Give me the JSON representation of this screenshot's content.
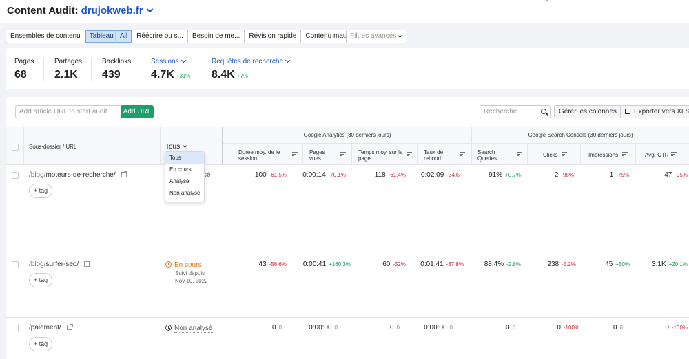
{
  "header": {
    "title": "Content Audit:",
    "domain": "drujokweb.fr"
  },
  "toolbar": {
    "view_group": [
      "Ensembles de contenu",
      "Tableau"
    ],
    "filter_group": [
      "All",
      "Réécrire ou s...",
      "Besoin de me...",
      "Révision rapide",
      "Contenu mau..."
    ],
    "advanced_filters": "Filtres avancés"
  },
  "stats": {
    "pages": {
      "label": "Pages",
      "value": "68"
    },
    "partages": {
      "label": "Partages",
      "value": "2.1K"
    },
    "backlinks": {
      "label": "Backlinks",
      "value": "439"
    },
    "sessions": {
      "label": "Sessions",
      "value": "4.7K",
      "delta": "+31%"
    },
    "requetes": {
      "label": "Requêtes de recherche",
      "value": "8.4K",
      "delta": "+7%"
    }
  },
  "actions": {
    "url_placeholder": "Add article URL to start audit",
    "add_url": "Add URL",
    "search_placeholder": "Recherche",
    "manage_columns": "Gérer les colonnes",
    "export": "Exporter vers XLSX"
  },
  "table": {
    "col_url": "Sous-dossier / URL",
    "status_filter": "Tous",
    "group_ga": "Google Analytics (30 derniers jours)",
    "group_gsc": "Google Search Console (30 derniers jours)",
    "cols": {
      "duree": "Durée moy. de le session",
      "pages_vues": "Pages vues",
      "temps": "Temps moy. sur la page",
      "taux": "Taux de rebond",
      "queries": "Search Queries",
      "clicks": "Clicks",
      "impressions": "Impressions",
      "ctr": "Avg. CTR"
    },
    "tag_label": "+ tag",
    "rows": [
      {
        "folder": "/blog/",
        "slug": "moteurs-de-recherche/",
        "status": "",
        "sub1": "",
        "sub2": "",
        "duree": "100",
        "duree_d": "-61.5%",
        "pages_vues": "0:00:14",
        "pages_vues_d": "-70.1%",
        "temps": "118",
        "temps_d": "-61.4%",
        "taux": "0:02:09",
        "taux_d": "-34%",
        "queries": "91%",
        "queries_d": "+0.7%",
        "clicks": "2",
        "clicks_d": "-98%",
        "impressions": "1",
        "impressions_d": "-75%",
        "ctr": "47",
        "ctr_d": "-95%"
      },
      {
        "folder": "/blog/",
        "slug": "surfer-seo/",
        "status": "En cours",
        "sub1": "Suivi depuis",
        "sub2": "Nov 10, 2022",
        "duree": "43",
        "duree_d": "-56.6%",
        "pages_vues": "0:00:41",
        "pages_vues_d": "+160.3%",
        "temps": "60",
        "temps_d": "-52%",
        "taux": "0:01:41",
        "taux_d": "-37.8%",
        "queries": "88.4%",
        "queries_d": "-2.8%",
        "clicks": "238",
        "clicks_d": "-5.2%",
        "impressions": "45",
        "impressions_d": "+50%",
        "ctr": "3.1K",
        "ctr_d": "+20.1%"
      },
      {
        "folder": "",
        "slug": "/paiement/",
        "status": "Non analysé",
        "sub1": "",
        "sub2": "",
        "duree": "0",
        "duree_d": "0",
        "pages_vues": "0:00:00",
        "pages_vues_d": "0",
        "temps": "0",
        "temps_d": "0",
        "taux": "0:00:00",
        "taux_d": "0",
        "queries": "0",
        "queries_d": "0",
        "clicks": "0",
        "clicks_d": "-100%",
        "impressions": "0",
        "impressions_d": "0",
        "ctr": "0",
        "ctr_d": "-100%"
      }
    ]
  },
  "dropdown": {
    "options": [
      "Tous",
      "En cours",
      "Analysé",
      "Non analysé"
    ],
    "behind_text": "sé"
  },
  "colors": {
    "accent": "#1a55c4",
    "green": "#1d9e6b",
    "negative": "#d12a3c",
    "positive": "#1a9a5a",
    "orange": "#e0751b"
  }
}
